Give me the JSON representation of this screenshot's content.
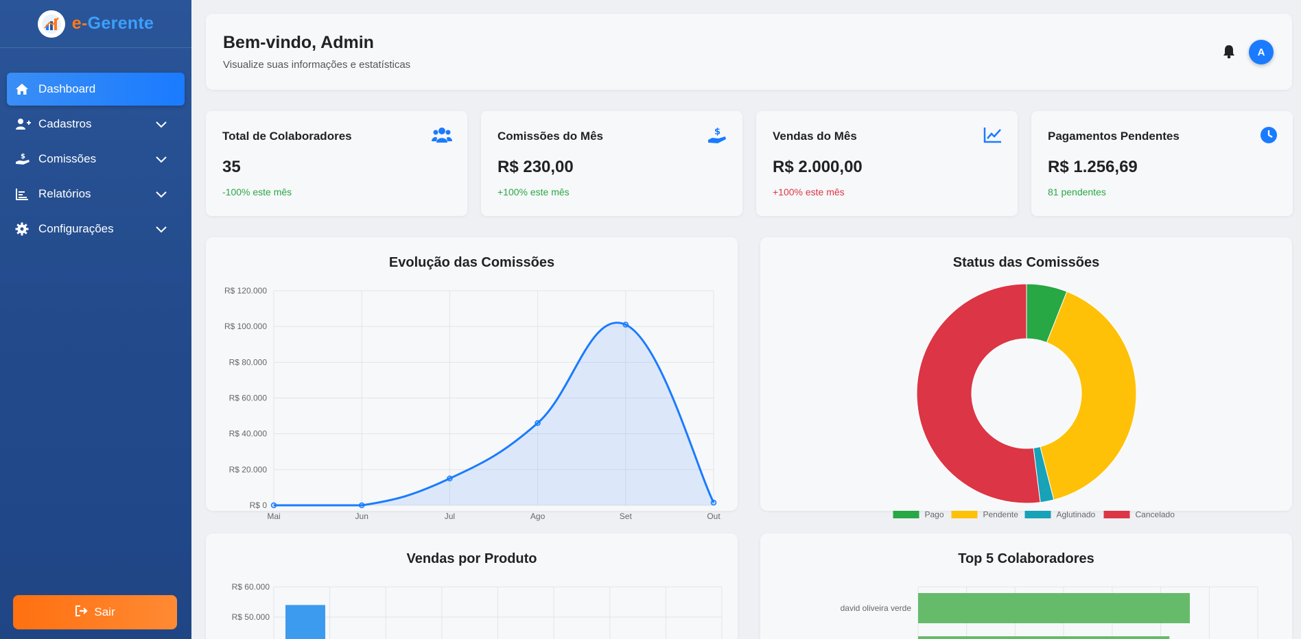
{
  "brand": {
    "prefix": "e-",
    "name": "Gerente"
  },
  "sidebar": {
    "items": [
      {
        "label": "Dashboard",
        "icon": "home-icon",
        "active": true
      },
      {
        "label": "Cadastros",
        "icon": "user-plus-icon"
      },
      {
        "label": "Comissões",
        "icon": "hand-dollar-icon"
      },
      {
        "label": "Relatórios",
        "icon": "chart-bars-icon"
      },
      {
        "label": "Configurações",
        "icon": "gear-icon"
      }
    ],
    "logout_label": "Sair"
  },
  "header": {
    "title": "Bem-vindo, Admin",
    "subtitle": "Visualize suas informações e estatísticas",
    "avatar_initial": "A"
  },
  "cards": [
    {
      "title": "Total de Colaboradores",
      "value": "35",
      "sub": "-100% este mês",
      "sub_color": "green",
      "icon": "users-icon"
    },
    {
      "title": "Comissões do Mês",
      "value": "R$ 230,00",
      "sub": "+100% este mês",
      "sub_color": "green",
      "icon": "hand-dollar-icon"
    },
    {
      "title": "Vendas do Mês",
      "value": "R$ 2.000,00",
      "sub": "+100% este mês",
      "sub_color": "red",
      "icon": "line-chart-icon"
    },
    {
      "title": "Pagamentos Pendentes",
      "value": "R$ 1.256,69",
      "sub": "81 pendentes",
      "sub_color": "green",
      "icon": "clock-icon"
    }
  ],
  "colors": {
    "accent": "#1a7bff",
    "green": "#28a745",
    "yellow": "#ffc107",
    "teal": "#17a2b8",
    "red": "#dc3545"
  },
  "chart_data": [
    {
      "type": "area",
      "title": "Evolução das Comissões",
      "categories": [
        "Mai",
        "Jun",
        "Jul",
        "Ago",
        "Set",
        "Out"
      ],
      "values": [
        0,
        0,
        15000,
        46000,
        101000,
        1500
      ],
      "ylim": [
        0,
        120000
      ],
      "yticks": [
        "R$ 0",
        "R$ 20.000",
        "R$ 40.000",
        "R$ 60.000",
        "R$ 80.000",
        "R$ 100.000",
        "R$ 120.000"
      ],
      "grid": true
    },
    {
      "type": "pie",
      "title": "Status das Comissões",
      "labels": [
        "Pago",
        "Pendente",
        "Aglutinado",
        "Cancelado"
      ],
      "values": [
        6,
        40,
        2,
        52
      ],
      "colors": [
        "#28a745",
        "#ffc107",
        "#17a2b8",
        "#dc3545"
      ],
      "legend": "bottom"
    },
    {
      "type": "bar",
      "title": "Vendas por Produto",
      "ylim_visible": [
        50000,
        60000
      ],
      "yticks": [
        "R$ 60.000",
        "R$ 50.000"
      ],
      "values": [
        54000
      ],
      "grid": true
    },
    {
      "type": "bar",
      "orientation": "horizontal",
      "title": "Top 5 Colaboradores",
      "categories": [
        "david oliveira verde"
      ],
      "values": [
        80
      ],
      "values_partial": [
        74
      ],
      "grid": true
    }
  ]
}
